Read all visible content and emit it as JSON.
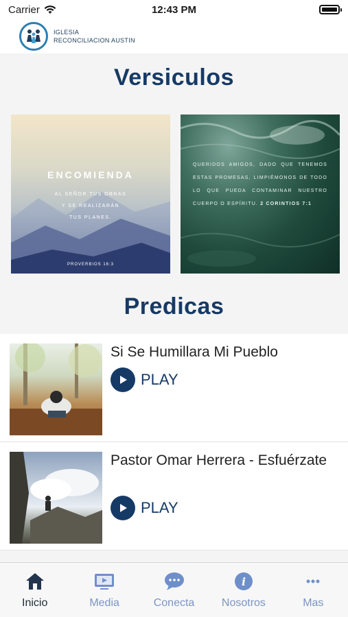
{
  "status_bar": {
    "carrier": "Carrier",
    "time": "12:43 PM"
  },
  "header": {
    "logo_line1": "IGLESIA",
    "logo_line2": "RECONCILIACION AUSTIN"
  },
  "versiculos": {
    "title": "Versiculos",
    "cards": [
      {
        "heading": "ENCOMIENDA",
        "lines": [
          "AL SEÑOR TUS OBRAS",
          "Y SE REALIZARÁN",
          "TUS PLANES."
        ],
        "reference": "PROVERBIOS 16:3"
      },
      {
        "text": "QUERIDOS AMIGOS, DADO QUE TENEMOS ESTAS PROMESAS, LIMPIÉMONOS DE TODO LO QUE PUEDA CONTAMINAR NUESTRO CUERPO O ESPÍRITU.",
        "reference": "2 CORINTIOS 7:1"
      }
    ]
  },
  "predicas": {
    "title": "Predicas",
    "items": [
      {
        "title": "Si Se Humillara Mi Pueblo",
        "play_label": "PLAY"
      },
      {
        "title": "Pastor Omar Herrera - Esfuérzate",
        "play_label": "PLAY"
      }
    ]
  },
  "tabs": [
    {
      "label": "Inicio",
      "icon": "home-icon",
      "active": true
    },
    {
      "label": "Media",
      "icon": "tv-icon",
      "active": false
    },
    {
      "label": "Conecta",
      "icon": "chat-bubble-icon",
      "active": false
    },
    {
      "label": "Nosotros",
      "icon": "info-icon",
      "active": false
    },
    {
      "label": "Mas",
      "icon": "more-dots-icon",
      "active": false
    }
  ],
  "colors": {
    "brand_navy": "#163a66",
    "tab_inactive": "#7a95c4",
    "tab_active": "#1e2a3a"
  }
}
